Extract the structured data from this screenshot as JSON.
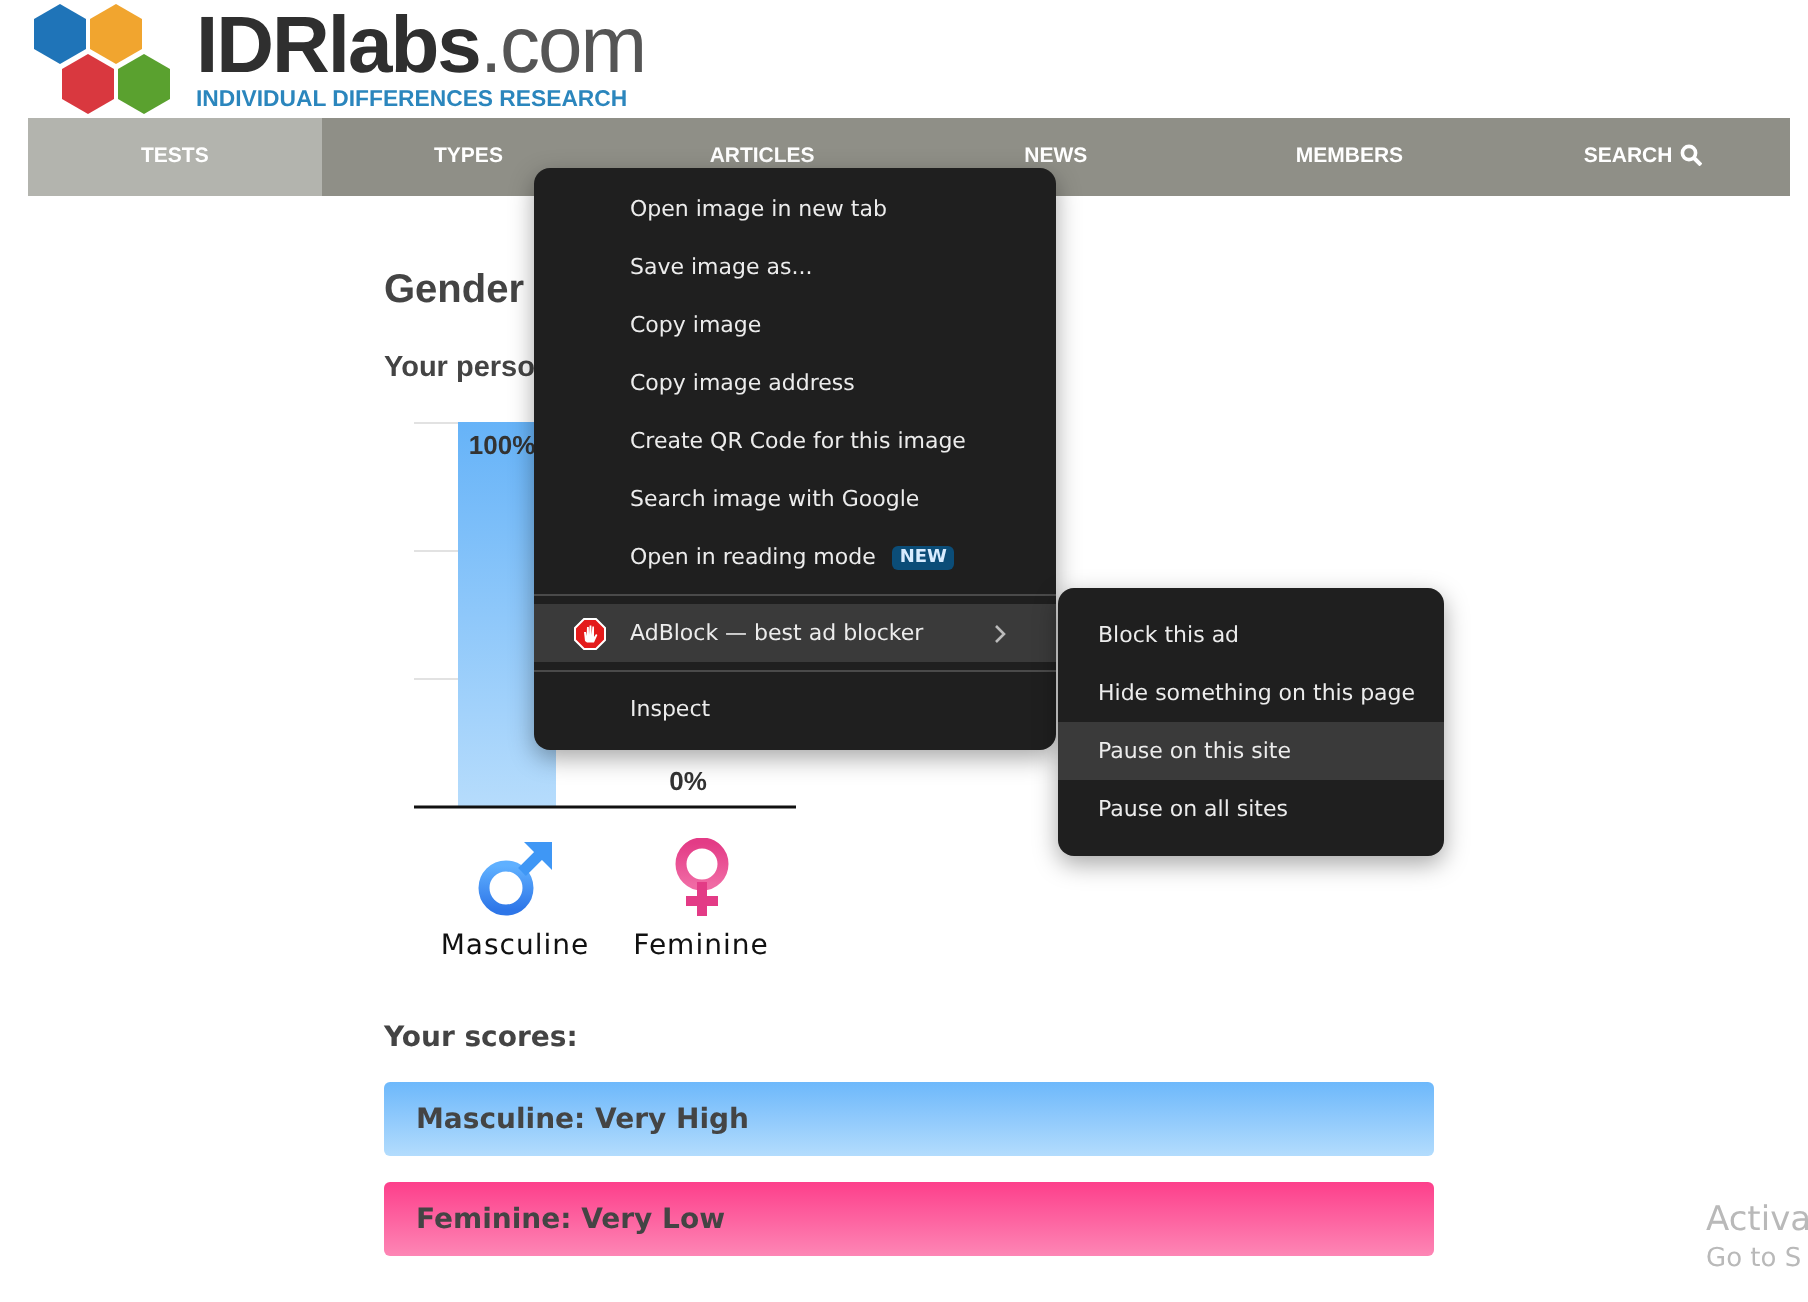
{
  "site": {
    "logo": {
      "name": "IDRlabs",
      "suffix": ".com",
      "tagline": "INDIVIDUAL DIFFERENCES RESEARCH"
    },
    "nav": [
      {
        "label": "TESTS",
        "selected": true
      },
      {
        "label": "TYPES",
        "selected": false
      },
      {
        "label": "ARTICLES",
        "selected": false
      },
      {
        "label": "NEWS",
        "selected": false
      },
      {
        "label": "MEMBERS",
        "selected": false
      },
      {
        "label": "SEARCH",
        "selected": false,
        "kind": "search"
      }
    ]
  },
  "page": {
    "title": "Gender",
    "subtitle": "Your perso",
    "chart_data": {
      "type": "bar",
      "categories": [
        "Masculine",
        "Feminine"
      ],
      "values": [
        100,
        0
      ],
      "value_labels": [
        "100%",
        "0%"
      ]
    },
    "legend": [
      {
        "kind": "male"
      },
      {
        "kind": "female"
      }
    ],
    "scores_heading": "Your scores:",
    "scores": [
      {
        "label": "Masculine: Very High",
        "kind": "male"
      },
      {
        "label": "Feminine: Very Low",
        "kind": "female"
      }
    ]
  },
  "context_menu": {
    "groups": [
      [
        {
          "label": "Open image in new tab",
          "selected": false
        },
        {
          "label": "Save image as...",
          "selected": false
        },
        {
          "label": "Copy image",
          "selected": false
        },
        {
          "label": "Copy image address",
          "selected": false
        },
        {
          "label": "Create QR Code for this image",
          "selected": false
        },
        {
          "label": "Search image with Google",
          "selected": false
        },
        {
          "label": "Open in reading mode",
          "badge": "NEW",
          "selected": false
        }
      ],
      [
        {
          "label": "AdBlock — best ad blocker",
          "kind": "extension",
          "has_submenu": true,
          "selected": true
        }
      ],
      [
        {
          "label": "Inspect",
          "selected": false
        }
      ]
    ],
    "submenu": [
      {
        "label": "Block this ad",
        "selected": false
      },
      {
        "label": "Hide something on this page",
        "selected": false
      },
      {
        "label": "Pause on this site",
        "selected": true
      },
      {
        "label": "Pause on all sites",
        "selected": false
      }
    ]
  },
  "activation_notice": {
    "title": "Activa",
    "subtitle": "Go to S"
  }
}
